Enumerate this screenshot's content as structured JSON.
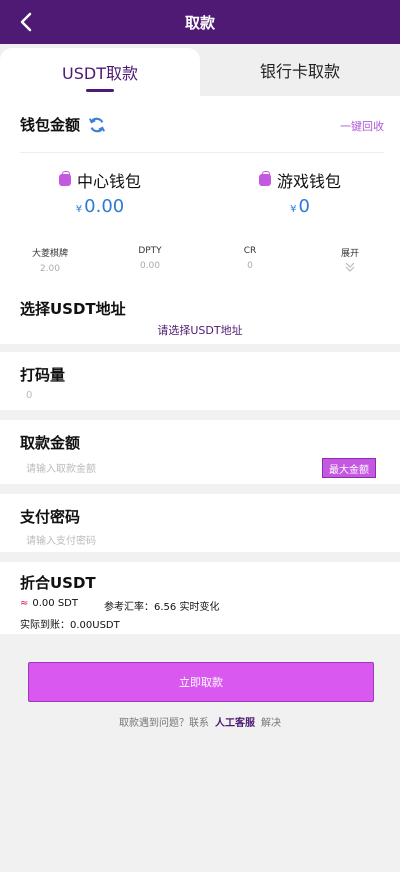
{
  "header": {
    "title": "取款"
  },
  "tabs": [
    {
      "label": "USDT取款"
    },
    {
      "label": "银行卡取款"
    }
  ],
  "wallet": {
    "title": "钱包金额",
    "recycle_label": "一键回收",
    "items": [
      {
        "name": "中心钱包",
        "currency": "¥",
        "amount": "0.00"
      },
      {
        "name": "游戏钱包",
        "currency": "¥",
        "amount": "0"
      }
    ],
    "games": [
      {
        "name": "大菱棋牌",
        "value": "2.00"
      },
      {
        "name": "DPTY",
        "value": "0.00"
      },
      {
        "name": "CR",
        "value": "0"
      },
      {
        "name": "展开",
        "value": ""
      }
    ],
    "usdt_title": "选择USDT地址",
    "usdt_placeholder": "请选择USDT地址"
  },
  "code": {
    "title": "打码量",
    "value": "0"
  },
  "amount": {
    "title": "取款金额",
    "placeholder": "请输入取款金额",
    "max_label": "最大金额"
  },
  "password": {
    "title": "支付密码",
    "placeholder": "请输入支付密码"
  },
  "convert": {
    "title": "折合USDT",
    "approx": "≈",
    "usdt_value": "0.00 SDT",
    "rate_text": "参考汇率：6.56 实时变化",
    "actual_text": "实际到账：0.00USDT"
  },
  "submit_label": "立即取款",
  "help": {
    "prefix": "取款遇到问题？联系",
    "link": "人工客服",
    "suffix": "解决"
  },
  "colors": {
    "brand": "#4e1a73",
    "accent": "#d958f0",
    "amount_blue": "#2d7bd6"
  }
}
